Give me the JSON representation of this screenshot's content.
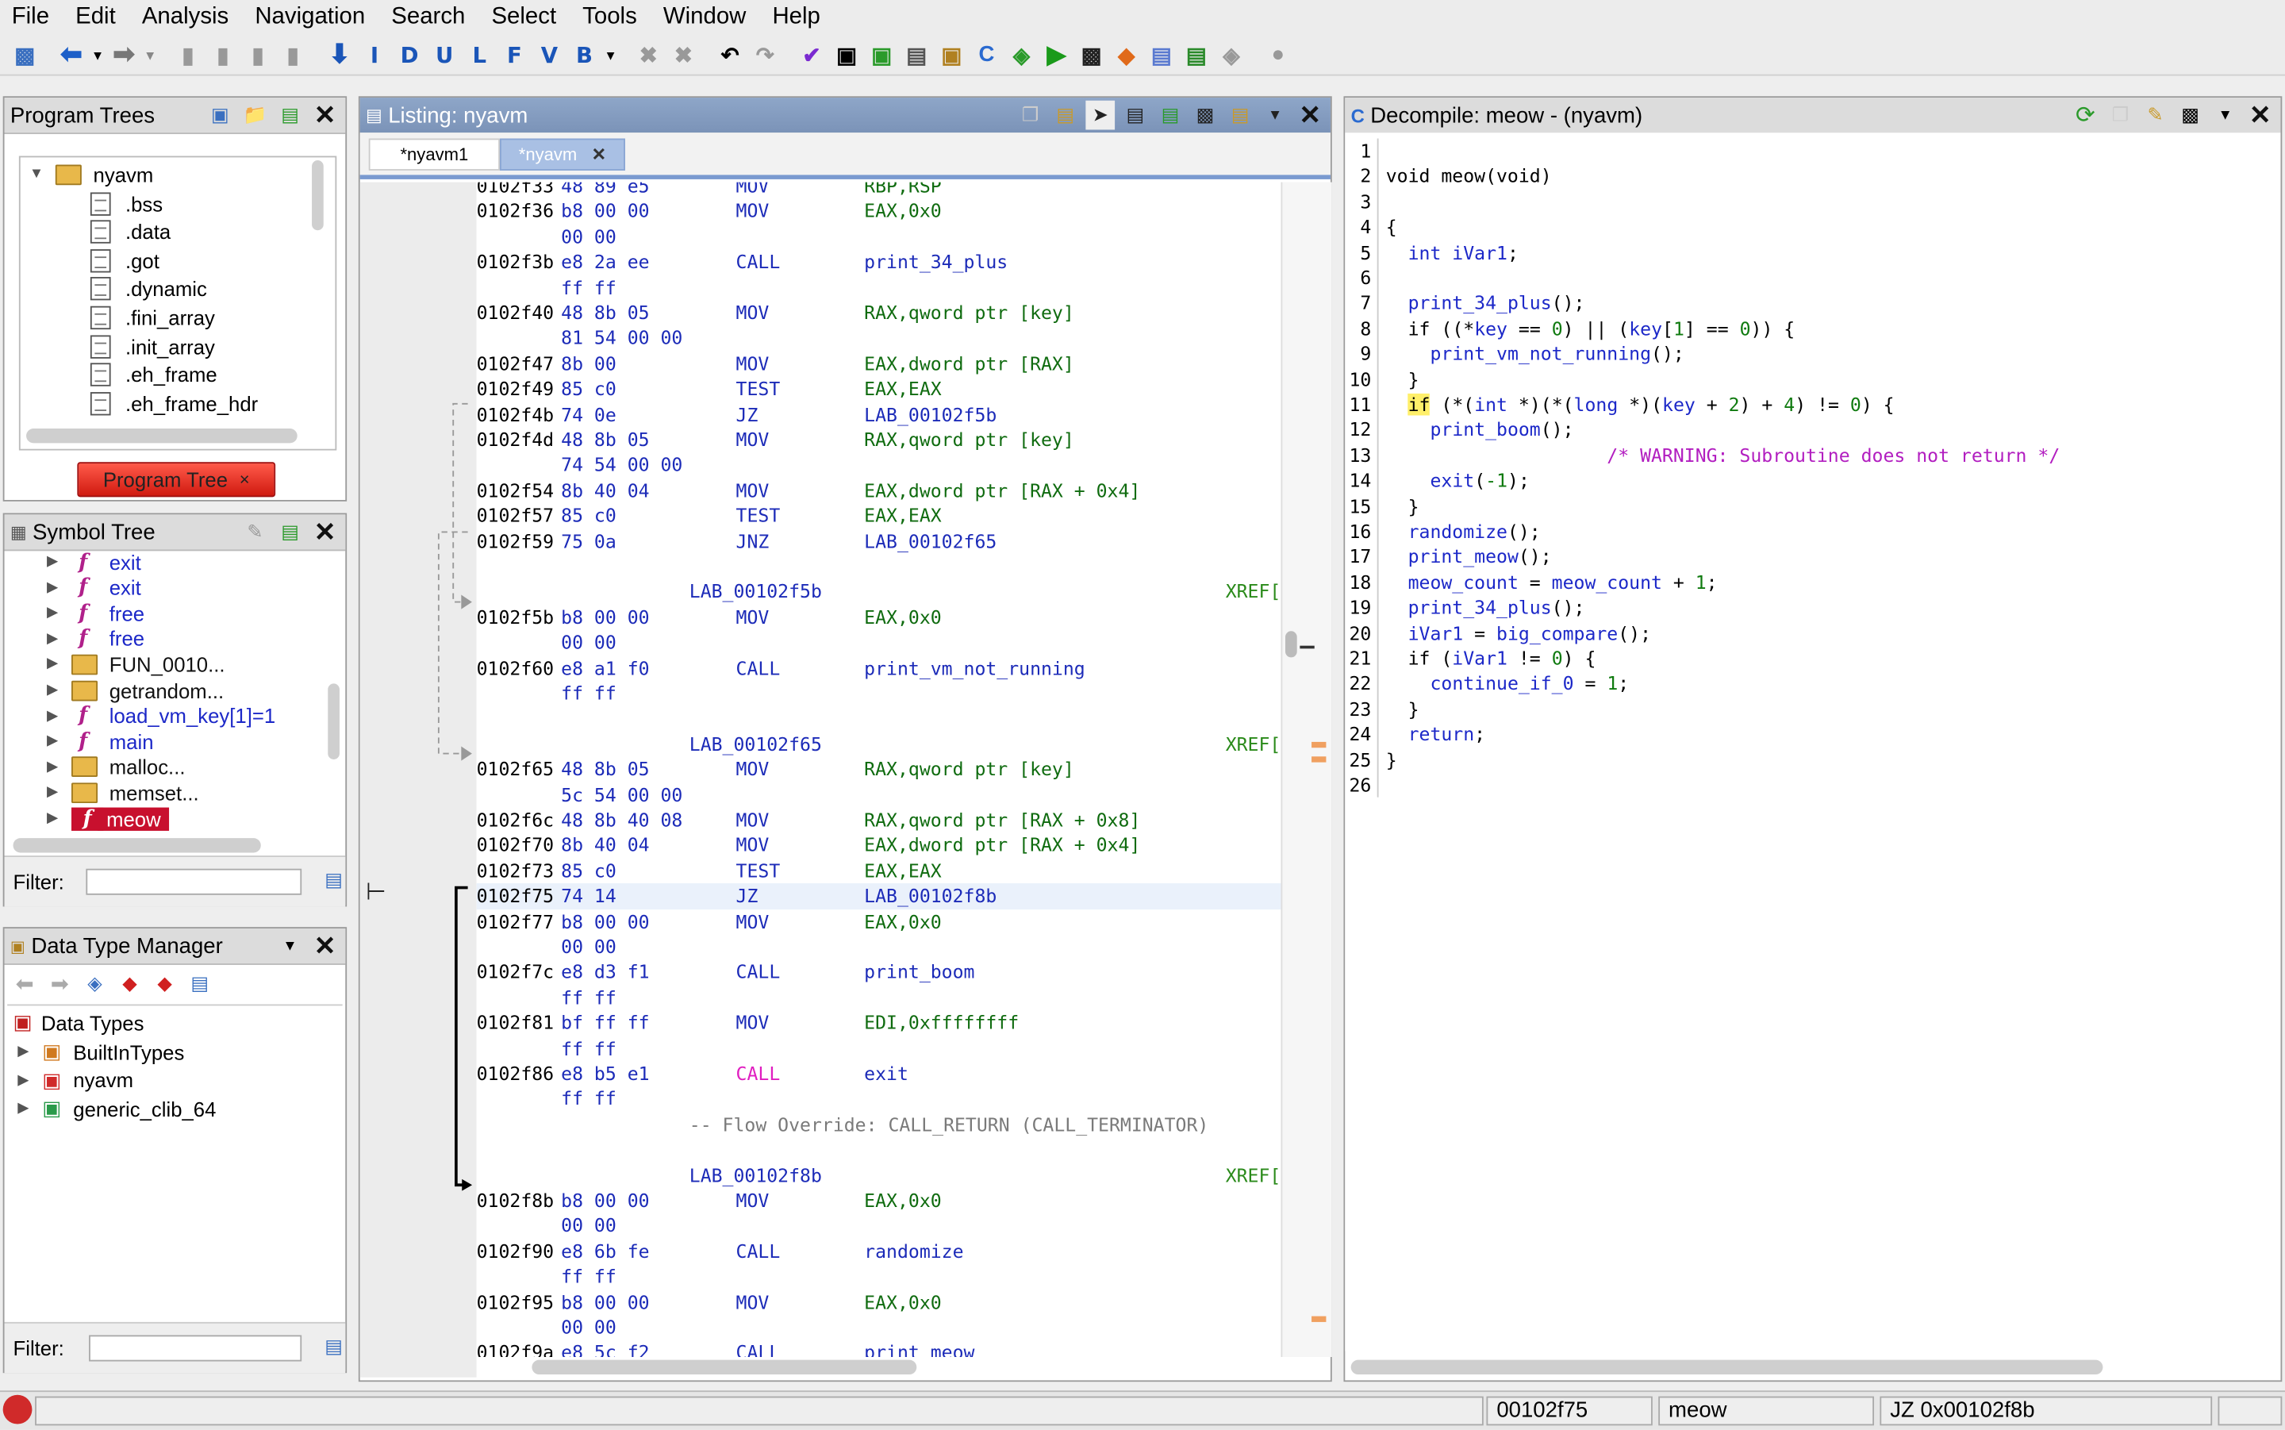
{
  "menu": [
    "File",
    "Edit",
    "Analysis",
    "Navigation",
    "Search",
    "Select",
    "Tools",
    "Window",
    "Help"
  ],
  "toolbar_letters": [
    "I",
    "D",
    "U",
    "L",
    "F",
    "V",
    "B"
  ],
  "program_trees": {
    "title": "Program Trees",
    "root": "nyavm",
    "sections": [
      ".bss",
      ".data",
      ".got",
      ".dynamic",
      ".fini_array",
      ".init_array",
      ".eh_frame",
      ".eh_frame_hdr"
    ],
    "tab_label": "Program Tree",
    "tab_close": "×"
  },
  "symbol_tree": {
    "title": "Symbol Tree",
    "items": [
      {
        "label": "exit",
        "kind": "ext"
      },
      {
        "label": "exit",
        "kind": "ext"
      },
      {
        "label": "free",
        "kind": "ext"
      },
      {
        "label": "free",
        "kind": "ext"
      },
      {
        "label": "FUN_0010...",
        "kind": "folder"
      },
      {
        "label": "getrandom...",
        "kind": "folder"
      },
      {
        "label": "load_vm_key[1]=1",
        "kind": "fn"
      },
      {
        "label": "main",
        "kind": "fn"
      },
      {
        "label": "malloc...",
        "kind": "folder"
      },
      {
        "label": "memset...",
        "kind": "folder"
      },
      {
        "label": "meow",
        "kind": "fn-selected"
      }
    ],
    "filter_label": "Filter:"
  },
  "data_type_manager": {
    "title": "Data Type Manager",
    "root": "Data Types",
    "items": [
      "BuiltInTypes",
      "nyavm",
      "generic_clib_64"
    ],
    "filter_label": "Filter:"
  },
  "listing": {
    "title": "Listing:  nyavm",
    "tabs": [
      {
        "label": "*nyavm1"
      },
      {
        "label": "*nyavm"
      }
    ],
    "rows": [
      {
        "addr": "0102f33",
        "bytes": "48 89 e5",
        "mnem": "MOV",
        "op": "RBP,RSP",
        "opclass": "op"
      },
      {
        "addr": "0102f36",
        "bytes": "b8 00 00",
        "mnem": "MOV",
        "op": "EAX,0x0",
        "opclass": "op"
      },
      {
        "addr": "",
        "bytes": "00 00",
        "mnem": "",
        "op": ""
      },
      {
        "addr": "0102f3b",
        "bytes": "e8 2a ee",
        "mnem": "CALL",
        "op": "print_34_plus",
        "opclass": "opblue"
      },
      {
        "addr": "",
        "bytes": "ff ff",
        "mnem": "",
        "op": ""
      },
      {
        "addr": "0102f40",
        "bytes": "48 8b 05",
        "mnem": "MOV",
        "op": "RAX,qword ptr [key]",
        "opclass": "op"
      },
      {
        "addr": "",
        "bytes": "81 54 00 00",
        "mnem": "",
        "op": ""
      },
      {
        "addr": "0102f47",
        "bytes": "8b 00",
        "mnem": "MOV",
        "op": "EAX,dword ptr [RAX]",
        "opclass": "op"
      },
      {
        "addr": "0102f49",
        "bytes": "85 c0",
        "mnem": "TEST",
        "op": "EAX,EAX",
        "opclass": "op"
      },
      {
        "addr": "0102f4b",
        "bytes": "74 0e",
        "mnem": "JZ",
        "op": "LAB_00102f5b",
        "opclass": "opblue"
      },
      {
        "addr": "0102f4d",
        "bytes": "48 8b 05",
        "mnem": "MOV",
        "op": "RAX,qword ptr [key]",
        "opclass": "op"
      },
      {
        "addr": "",
        "bytes": "74 54 00 00",
        "mnem": "",
        "op": ""
      },
      {
        "addr": "0102f54",
        "bytes": "8b 40 04",
        "mnem": "MOV",
        "op": "EAX,dword ptr [RAX + 0x4]",
        "opclass": "op"
      },
      {
        "addr": "0102f57",
        "bytes": "85 c0",
        "mnem": "TEST",
        "op": "EAX,EAX",
        "opclass": "op"
      },
      {
        "addr": "0102f59",
        "bytes": "75 0a",
        "mnem": "JNZ",
        "op": "LAB_00102f65",
        "opclass": "opblue"
      },
      {
        "addr": "",
        "bytes": "",
        "mnem": "",
        "op": ""
      },
      {
        "label": "LAB_00102f5b",
        "xref": "XREF["
      },
      {
        "addr": "0102f5b",
        "bytes": "b8 00 00",
        "mnem": "MOV",
        "op": "EAX,0x0",
        "opclass": "op"
      },
      {
        "addr": "",
        "bytes": "00 00",
        "mnem": "",
        "op": ""
      },
      {
        "addr": "0102f60",
        "bytes": "e8 a1 f0",
        "mnem": "CALL",
        "op": "print_vm_not_running",
        "opclass": "opblue"
      },
      {
        "addr": "",
        "bytes": "ff ff",
        "mnem": "",
        "op": ""
      },
      {
        "addr": "",
        "bytes": "",
        "mnem": "",
        "op": ""
      },
      {
        "label": "LAB_00102f65",
        "xref": "XREF["
      },
      {
        "addr": "0102f65",
        "bytes": "48 8b 05",
        "mnem": "MOV",
        "op": "RAX,qword ptr [key]",
        "opclass": "op"
      },
      {
        "addr": "",
        "bytes": "5c 54 00 00",
        "mnem": "",
        "op": ""
      },
      {
        "addr": "0102f6c",
        "bytes": "48 8b 40 08",
        "mnem": "MOV",
        "op": "RAX,qword ptr [RAX + 0x8]",
        "opclass": "op"
      },
      {
        "addr": "0102f70",
        "bytes": "8b 40 04",
        "mnem": "MOV",
        "op": "EAX,dword ptr [RAX + 0x4]",
        "opclass": "op"
      },
      {
        "addr": "0102f73",
        "bytes": "85 c0",
        "mnem": "TEST",
        "op": "EAX,EAX",
        "opclass": "op"
      },
      {
        "addr": "0102f75",
        "bytes": "74 14",
        "mnem": "JZ",
        "op": "LAB_00102f8b",
        "opclass": "opblue",
        "current": true
      },
      {
        "addr": "0102f77",
        "bytes": "b8 00 00",
        "mnem": "MOV",
        "op": "EAX,0x0",
        "opclass": "op"
      },
      {
        "addr": "",
        "bytes": "00 00",
        "mnem": "",
        "op": ""
      },
      {
        "addr": "0102f7c",
        "bytes": "e8 d3 f1",
        "mnem": "CALL",
        "op": "print_boom",
        "opclass": "opblue"
      },
      {
        "addr": "",
        "bytes": "ff ff",
        "mnem": "",
        "op": ""
      },
      {
        "addr": "0102f81",
        "bytes": "bf ff ff",
        "mnem": "MOV",
        "op": "EDI,0xffffffff",
        "opclass": "op"
      },
      {
        "addr": "",
        "bytes": "ff ff",
        "mnem": "",
        "op": ""
      },
      {
        "addr": "0102f86",
        "bytes": "e8 b5 e1",
        "mnem": "CALL",
        "op": "exit",
        "opclass": "opblue",
        "mnemclass": "call"
      },
      {
        "addr": "",
        "bytes": "ff ff",
        "mnem": "",
        "op": ""
      },
      {
        "comment": "-- Flow Override: CALL_RETURN (CALL_TERMINATOR)"
      },
      {
        "addr": "",
        "bytes": "",
        "mnem": "",
        "op": ""
      },
      {
        "label": "LAB_00102f8b",
        "xref": "XREF["
      },
      {
        "addr": "0102f8b",
        "bytes": "b8 00 00",
        "mnem": "MOV",
        "op": "EAX,0x0",
        "opclass": "op"
      },
      {
        "addr": "",
        "bytes": "00 00",
        "mnem": "",
        "op": ""
      },
      {
        "addr": "0102f90",
        "bytes": "e8 6b fe",
        "mnem": "CALL",
        "op": "randomize",
        "opclass": "opblue"
      },
      {
        "addr": "",
        "bytes": "ff ff",
        "mnem": "",
        "op": ""
      },
      {
        "addr": "0102f95",
        "bytes": "b8 00 00",
        "mnem": "MOV",
        "op": "EAX,0x0",
        "opclass": "op"
      },
      {
        "addr": "",
        "bytes": "00 00",
        "mnem": "",
        "op": ""
      },
      {
        "addr": "0102f9a",
        "bytes": "e8 5c f2",
        "mnem": "CALL",
        "op": "print_meow",
        "opclass": "opblue"
      }
    ]
  },
  "decompile": {
    "title": "Decompile: meow -  (nyavm)",
    "lines": [
      [],
      [
        [
          "void meow(void)",
          ""
        ]
      ],
      [],
      [
        [
          "{",
          ""
        ]
      ],
      [
        [
          "  int ",
          "k-blue"
        ],
        [
          "iVar1",
          "k-blue"
        ],
        [
          ";",
          ""
        ]
      ],
      [],
      [
        [
          "  ",
          ""
        ],
        [
          "print_34_plus",
          "k-blue"
        ],
        [
          "();",
          ""
        ]
      ],
      [
        [
          "  if",
          ""
        ],
        [
          " ((*",
          ""
        ],
        [
          "key",
          "k-blue"
        ],
        [
          " == ",
          ""
        ],
        [
          "0",
          "k-grn"
        ],
        [
          ") || (",
          ""
        ],
        [
          "key",
          "k-blue"
        ],
        [
          "[",
          ""
        ],
        [
          "1",
          "k-grn"
        ],
        [
          "] == ",
          ""
        ],
        [
          "0",
          "k-grn"
        ],
        [
          ")) {",
          ""
        ]
      ],
      [
        [
          "    ",
          ""
        ],
        [
          "print_vm_not_running",
          "k-blue"
        ],
        [
          "();",
          ""
        ]
      ],
      [
        [
          "  }",
          ""
        ]
      ],
      [
        [
          "  ",
          ""
        ],
        [
          "if",
          "k-hl"
        ],
        [
          " (*(",
          ""
        ],
        [
          "int",
          "k-blue"
        ],
        [
          " *)(*(",
          ""
        ],
        [
          "long",
          "k-blue"
        ],
        [
          " *)(",
          ""
        ],
        [
          "key",
          "k-blue"
        ],
        [
          " + ",
          ""
        ],
        [
          "2",
          "k-grn"
        ],
        [
          ") + ",
          ""
        ],
        [
          "4",
          "k-grn"
        ],
        [
          ") != ",
          ""
        ],
        [
          "0",
          "k-grn"
        ],
        [
          ") {",
          ""
        ]
      ],
      [
        [
          "    ",
          ""
        ],
        [
          "print_boom",
          "k-blue"
        ],
        [
          "();",
          ""
        ]
      ],
      [
        [
          "                    ",
          ""
        ],
        [
          "/* WARNING: Subroutine does not return */",
          "k-mag"
        ]
      ],
      [
        [
          "    ",
          ""
        ],
        [
          "exit",
          "k-blue"
        ],
        [
          "(",
          ""
        ],
        [
          "-1",
          "k-grn"
        ],
        [
          ");",
          ""
        ]
      ],
      [
        [
          "  }",
          ""
        ]
      ],
      [
        [
          "  ",
          ""
        ],
        [
          "randomize",
          "k-blue"
        ],
        [
          "();",
          ""
        ]
      ],
      [
        [
          "  ",
          ""
        ],
        [
          "print_meow",
          "k-blue"
        ],
        [
          "();",
          ""
        ]
      ],
      [
        [
          "  ",
          ""
        ],
        [
          "meow_count",
          "k-blue"
        ],
        [
          " = ",
          ""
        ],
        [
          "meow_count",
          "k-blue"
        ],
        [
          " + ",
          ""
        ],
        [
          "1",
          "k-grn"
        ],
        [
          ";",
          ""
        ]
      ],
      [
        [
          "  ",
          ""
        ],
        [
          "print_34_plus",
          "k-blue"
        ],
        [
          "();",
          ""
        ]
      ],
      [
        [
          "  ",
          ""
        ],
        [
          "iVar1",
          "k-blue"
        ],
        [
          " = ",
          ""
        ],
        [
          "big_compare",
          "k-blue"
        ],
        [
          "();",
          ""
        ]
      ],
      [
        [
          "  if (",
          ""
        ],
        [
          "iVar1",
          "k-blue"
        ],
        [
          " != ",
          ""
        ],
        [
          "0",
          "k-grn"
        ],
        [
          ") {",
          ""
        ]
      ],
      [
        [
          "    ",
          ""
        ],
        [
          "continue_if_0",
          "k-blue"
        ],
        [
          " = ",
          ""
        ],
        [
          "1",
          "k-grn"
        ],
        [
          ";",
          ""
        ]
      ],
      [
        [
          "  }",
          ""
        ]
      ],
      [
        [
          "  ",
          ""
        ],
        [
          "return",
          "k-blue"
        ],
        [
          ";",
          ""
        ]
      ],
      [
        [
          "}",
          ""
        ]
      ],
      []
    ]
  },
  "status": {
    "address": "00102f75",
    "function": "meow",
    "instruction": "JZ 0x00102f8b"
  }
}
